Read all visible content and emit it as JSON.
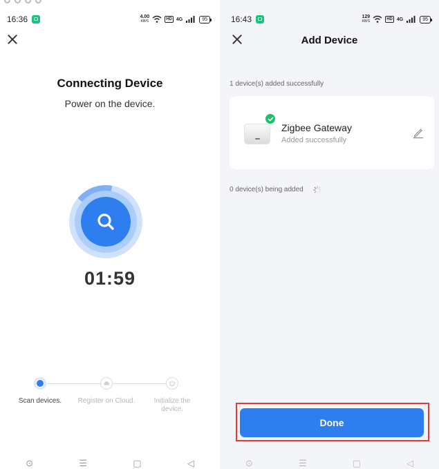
{
  "left_screen": {
    "status_bar": {
      "time": "16:36",
      "speed_value": "4.00",
      "speed_unit": "KB/S",
      "network_label": "4G",
      "hd_label": "HD",
      "battery": "95"
    },
    "title": "Connecting Device",
    "subtitle": "Power on the device.",
    "countdown": "01:59",
    "steps": [
      {
        "label": "Scan devices.",
        "state": "active"
      },
      {
        "label": "Register on Cloud.",
        "state": "pending"
      },
      {
        "label": "Initialize the device.",
        "state": "pending"
      }
    ]
  },
  "right_screen": {
    "status_bar": {
      "time": "16:43",
      "speed_value": "129",
      "speed_unit": "KB/S",
      "network_label": "4G",
      "hd_label": "HD",
      "battery": "95"
    },
    "title": "Add Device",
    "added_summary": "1 device(s) added successfully",
    "device": {
      "name": "Zigbee Gateway",
      "status": "Added successfully"
    },
    "pending_summary": "0 device(s) being added",
    "done_label": "Done"
  },
  "colors": {
    "accent": "#2f7ef0",
    "success": "#1ec06a",
    "highlight": "#e53935"
  },
  "icons": {
    "close": "close-icon",
    "search": "search-icon",
    "cloud": "cloud-icon",
    "power": "power-icon",
    "edit": "pencil-icon",
    "check": "check-icon",
    "spinner": "loading-spinner-icon"
  }
}
